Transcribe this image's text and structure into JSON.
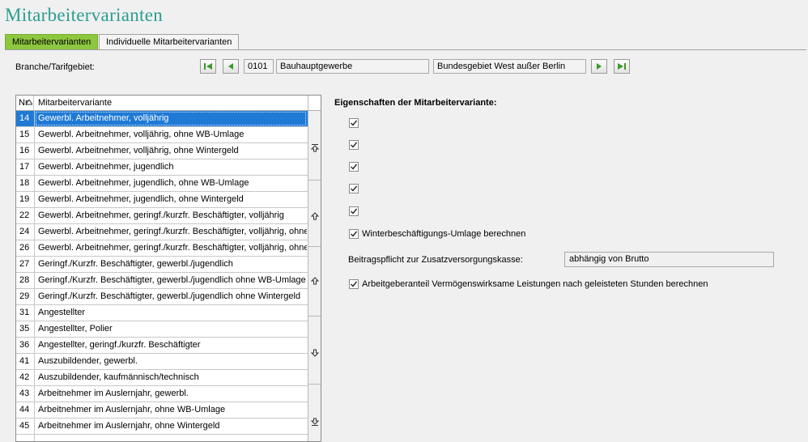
{
  "app": {
    "title": "Mitarbeitervarianten"
  },
  "tabs": [
    {
      "label": "Mitarbeitervarianten",
      "active": true
    },
    {
      "label": "Individuelle Mitarbeitervarianten",
      "active": false
    }
  ],
  "filter": {
    "label": "Branche/Tarifgebiet:",
    "code": "0101",
    "branche": "Bauhauptgewerbe",
    "tarifgebiet": "Bundesgebiet West außer Berlin"
  },
  "grid": {
    "columns": [
      "Nr",
      "Mitarbeitervariante"
    ],
    "rows": [
      {
        "nr": "14",
        "name": "Gewerbl. Arbeitnehmer, volljährig",
        "selected": true
      },
      {
        "nr": "15",
        "name": "Gewerbl. Arbeitnehmer, volljährig, ohne WB-Umlage"
      },
      {
        "nr": "16",
        "name": "Gewerbl. Arbeitnehmer, volljährig, ohne Wintergeld"
      },
      {
        "nr": "17",
        "name": "Gewerbl. Arbeitnehmer, jugendlich"
      },
      {
        "nr": "18",
        "name": "Gewerbl. Arbeitnehmer, jugendlich, ohne WB-Umlage"
      },
      {
        "nr": "19",
        "name": "Gewerbl. Arbeitnehmer, jugendlich, ohne Wintergeld"
      },
      {
        "nr": "22",
        "name": "Gewerbl. Arbeitnehmer, geringf./kurzfr. Beschäftigter, volljährig"
      },
      {
        "nr": "24",
        "name": "Gewerbl. Arbeitnehmer, geringf./kurzfr. Beschäftigter, volljährig, ohne W"
      },
      {
        "nr": "26",
        "name": "Gewerbl. Arbeitnehmer, geringf./kurzfr. Beschäftigter, volljährig, ohne W"
      },
      {
        "nr": "27",
        "name": "Geringf./Kurzfr. Beschäftigter, gewerbl./jugendlich"
      },
      {
        "nr": "28",
        "name": "Geringf./Kurzfr. Beschäftigter, gewerbl./jugendlich ohne WB-Umlage"
      },
      {
        "nr": "29",
        "name": "Geringf./Kurzfr. Beschäftigter, gewerbl./jugendlich ohne Wintergeld"
      },
      {
        "nr": "31",
        "name": "Angestellter"
      },
      {
        "nr": "35",
        "name": "Angestellter, Polier"
      },
      {
        "nr": "36",
        "name": "Angestellter, geringf./kurzfr. Beschäftigter"
      },
      {
        "nr": "41",
        "name": "Auszubildender, gewerbl."
      },
      {
        "nr": "42",
        "name": "Auszubildender, kaufmännisch/technisch"
      },
      {
        "nr": "43",
        "name": "Arbeitnehmer im Auslernjahr, gewerbl."
      },
      {
        "nr": "44",
        "name": "Arbeitnehmer im Auslernjahr, ohne WB-Umlage"
      },
      {
        "nr": "45",
        "name": "Arbeitnehmer im Auslernjahr, ohne Wintergeld"
      },
      {
        "nr": "",
        "name": ""
      }
    ]
  },
  "properties": {
    "heading": "Eigenschaften der Mitarbeitervariante:",
    "checkboxes": [
      {
        "label": "",
        "checked": true
      },
      {
        "label": "",
        "checked": true
      },
      {
        "label": "",
        "checked": true
      },
      {
        "label": "",
        "checked": true
      },
      {
        "label": "",
        "checked": true
      },
      {
        "label": "Winterbeschäftigungs-Umlage berechnen",
        "checked": true
      }
    ],
    "zusatz_label": "Beitragspflicht zur Zusatzversorgungskasse:",
    "zusatz_value": "abhängig von Brutto",
    "vl_label": "Arbeitgeberanteil Vermögenswirksame Leistungen nach geleisteten Stunden berechnen",
    "vl_checked": true
  },
  "colors": {
    "title": "#2a9d8f",
    "active_tab": "#8dc63f",
    "selection": "#1f7ad6",
    "nav_green": "#3a9a2a"
  }
}
